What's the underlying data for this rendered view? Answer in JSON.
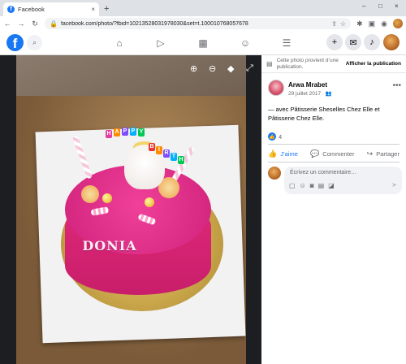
{
  "browser": {
    "tab_title": "Facebook",
    "tab_close": "×",
    "new_tab": "+",
    "url": "facebook.com/photo/?fbid=10213528031978030&set=t.100010768057678",
    "window_controls": [
      "–",
      "□",
      "×"
    ],
    "nav": {
      "back": "←",
      "forward": "→",
      "reload": "C"
    }
  },
  "fb_nav": {
    "logo": "f",
    "icons": [
      "home-icon",
      "watch-icon",
      "marketplace-icon",
      "groups-icon",
      "menu-icon"
    ],
    "right_buttons": [
      "+",
      "messenger",
      "notifications"
    ]
  },
  "photo": {
    "cake_name": "DONIA",
    "candles": [
      "H",
      "A",
      "P",
      "P",
      "Y",
      "B",
      "I",
      "R",
      "T",
      "H"
    ]
  },
  "panel": {
    "notice_text": "Cette photo provient d’une publication.",
    "notice_link": "Afficher la publication",
    "author": "Arwa Mrabet",
    "date": "29 juillet 2017",
    "post_text": "— avec Pâtisserie Sheselles Chez Elle et Pâtisserie Chez Elle.",
    "reaction_count": "4",
    "actions": {
      "like": "J’aime",
      "comment": "Commenter",
      "share": "Partager"
    },
    "comment_placeholder": "Écrivez un commentaire…"
  },
  "colors": {
    "fb_blue": "#1877f2",
    "cake_pink": "#e0287a"
  }
}
